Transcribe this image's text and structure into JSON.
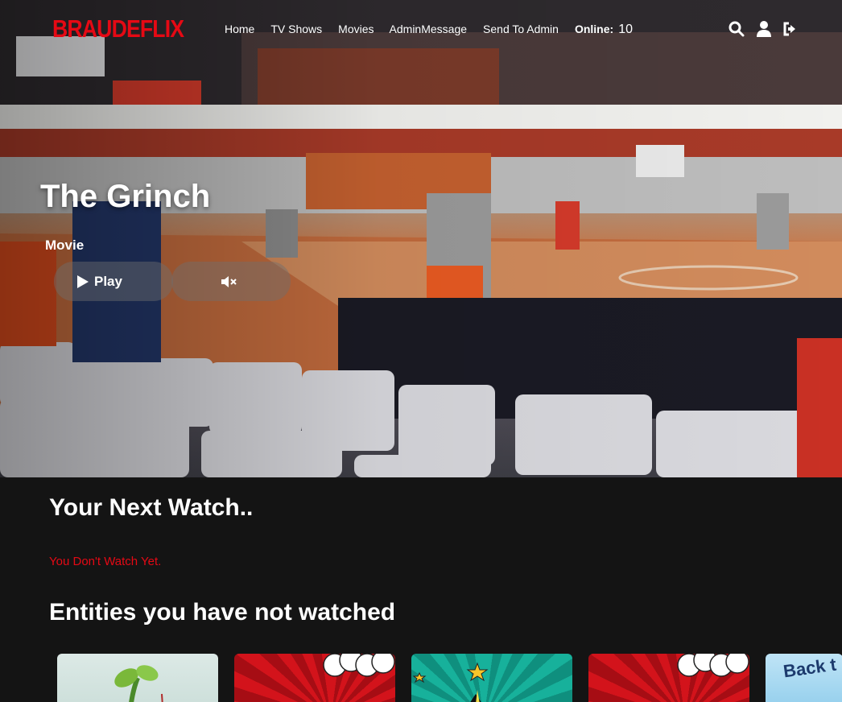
{
  "brand": {
    "name": "BRAUDEFLIX",
    "color": "#e50914"
  },
  "nav": {
    "links": [
      "Home",
      "TV Shows",
      "Movies",
      "AdminMessage",
      "Send To Admin"
    ],
    "online_label": "Online:",
    "online_count": "10",
    "icons": [
      "search-icon",
      "user-icon",
      "logout-icon"
    ]
  },
  "hero": {
    "title": "The Grinch",
    "type": "Movie",
    "play_label": "Play",
    "play_icon": "play-icon",
    "mute_icon": "volume-mute-icon"
  },
  "next_watch": {
    "title": "Your Next Watch..",
    "empty_message": "You Don't Watch Yet."
  },
  "not_watched": {
    "title": "Entities you have not watched",
    "cards": [
      {
        "art": "plant-art"
      },
      {
        "art": "comic-burst-art"
      },
      {
        "art": "comic-star-art"
      },
      {
        "art": "comic-burst-art"
      },
      {
        "art": "back-to-school-art",
        "text": "Back t"
      }
    ]
  },
  "colors": {
    "background": "#141414",
    "accent": "#e50914",
    "text": "#ffffff"
  }
}
